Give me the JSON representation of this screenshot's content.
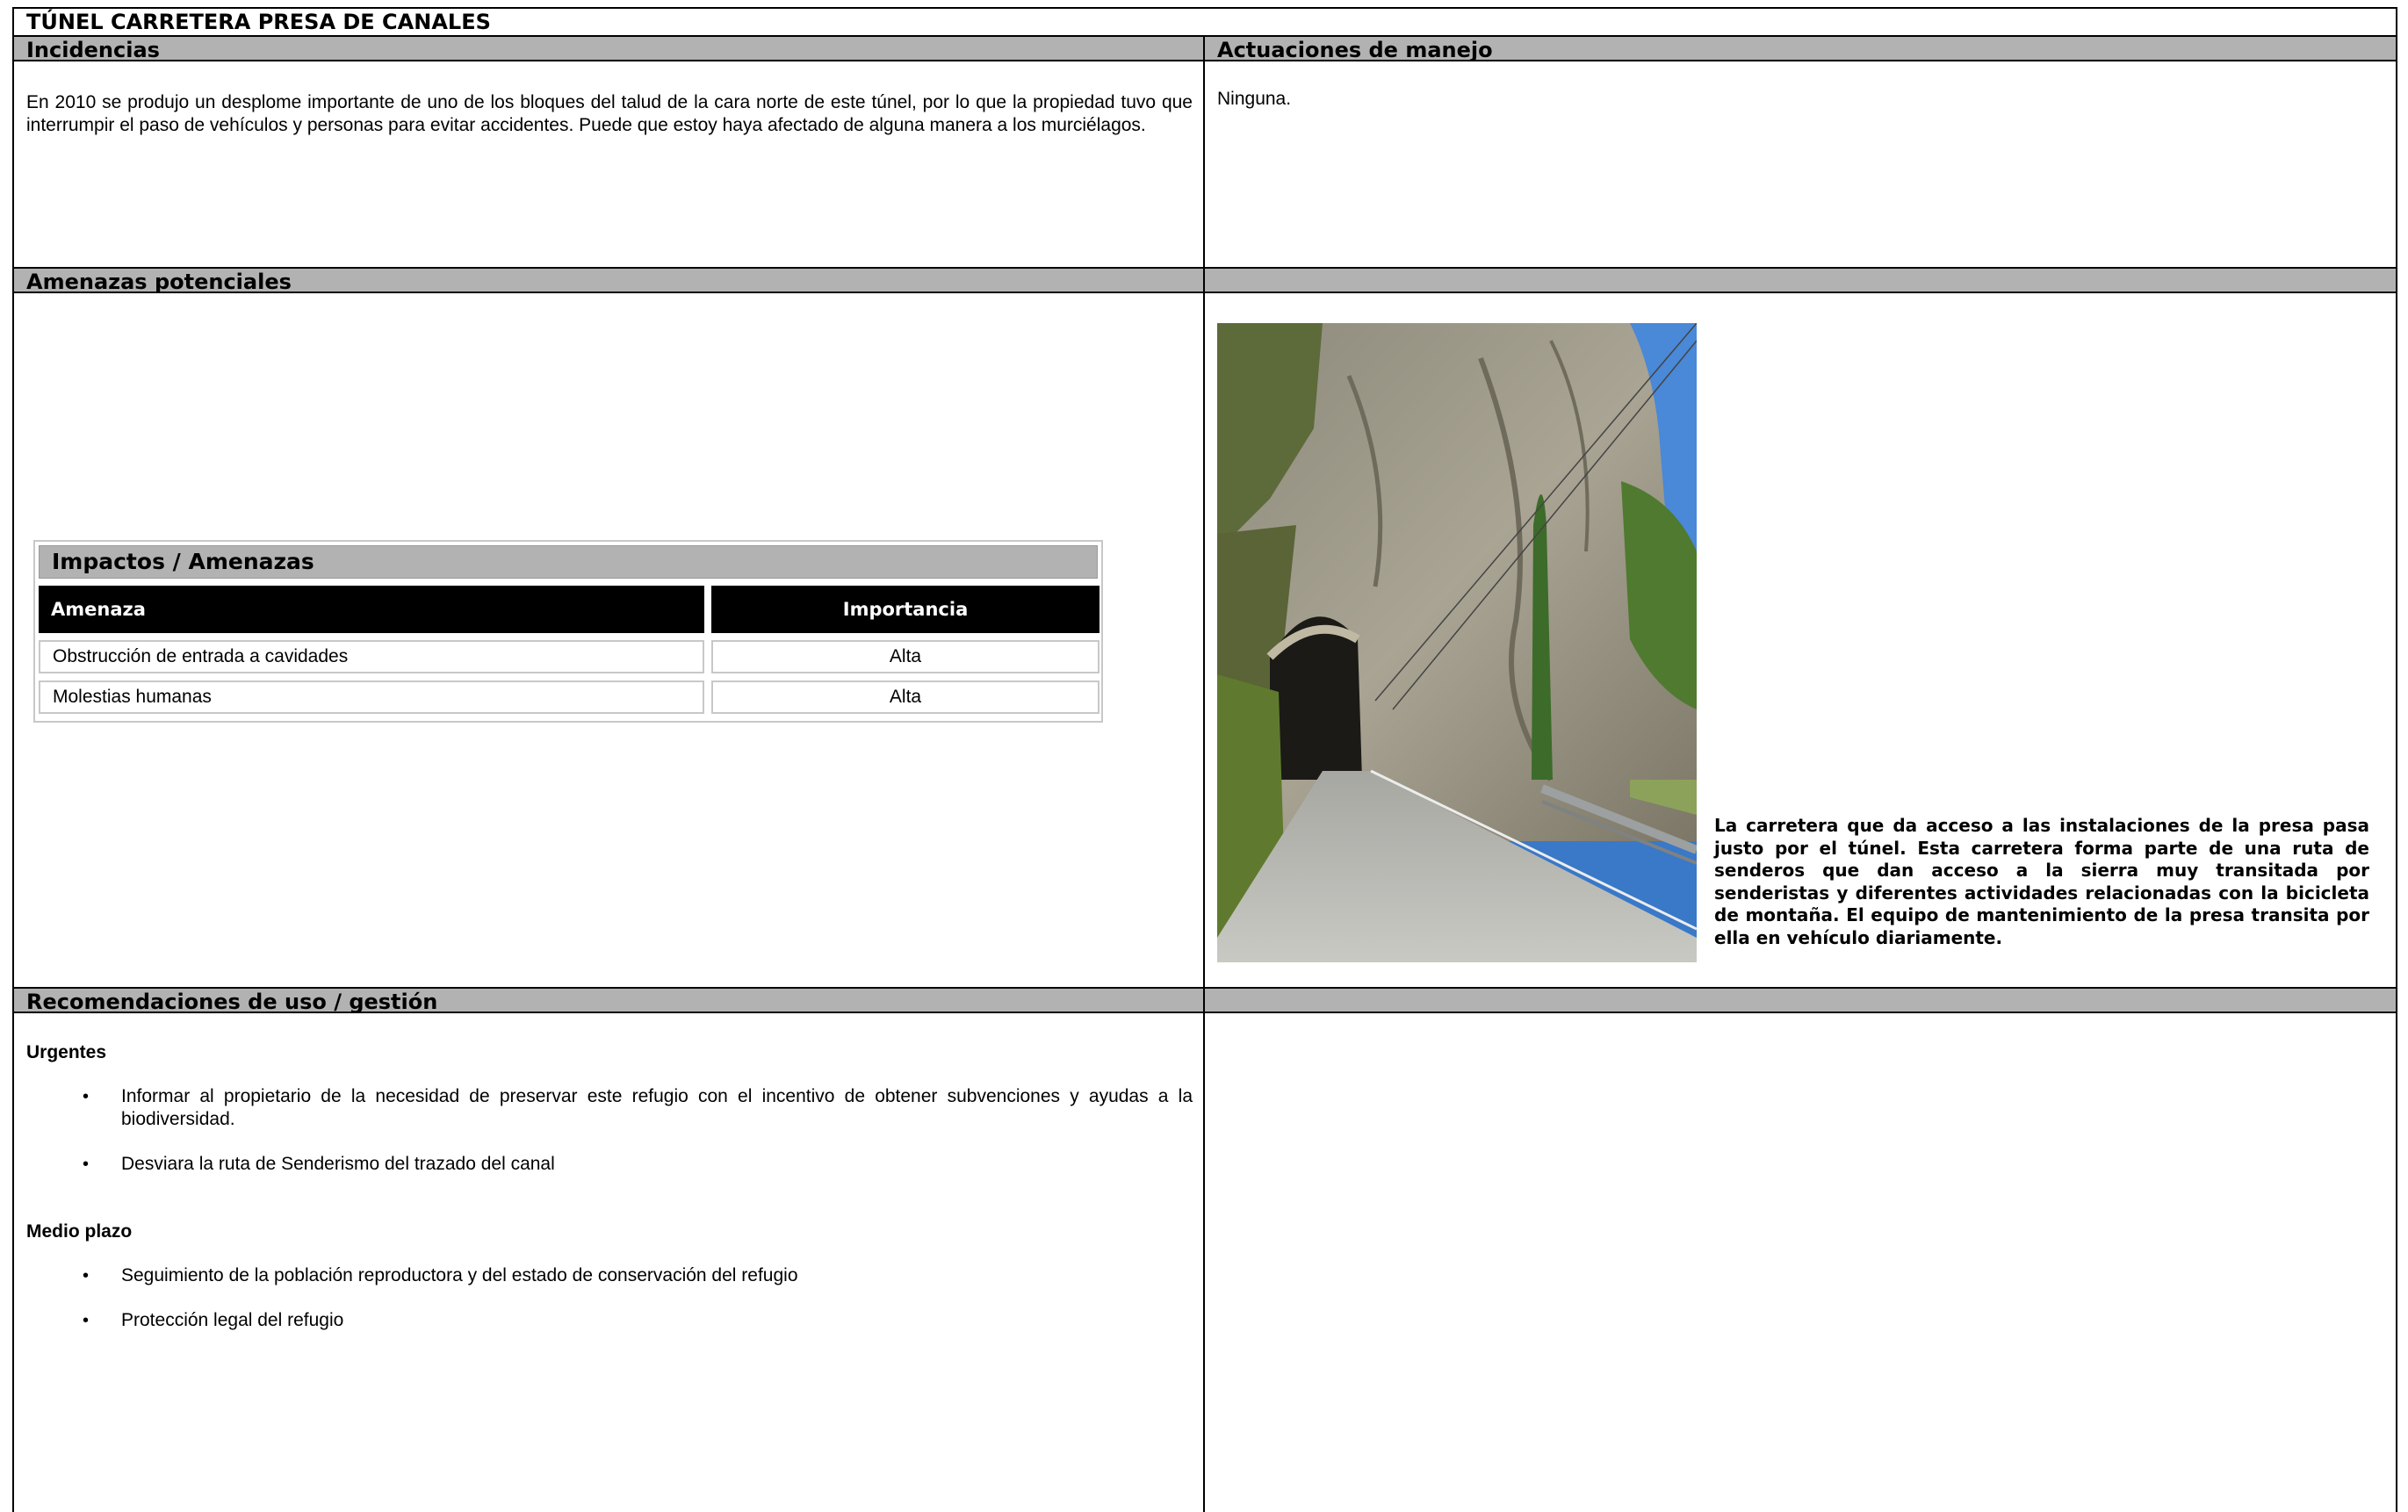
{
  "title": "TÚNEL CARRETERA PRESA DE CANALES",
  "sections": {
    "incidencias": {
      "heading": "Incidencias",
      "text": "En 2010 se produjo un desplome importante de uno de los bloques del talud  de la cara norte de este túnel, por lo que la propiedad tuvo que interrumpir el paso de vehículos y personas para evitar accidentes. Puede que estoy haya afectado de alguna manera a los murciélagos."
    },
    "actuaciones": {
      "heading": "Actuaciones de manejo",
      "text": "Ninguna."
    },
    "amenazas": {
      "heading": "Amenazas potenciales"
    },
    "impactos_table": {
      "title": "Impactos / Amenazas",
      "col_amenaza": "Amenaza",
      "col_importancia": "Importancia",
      "rows": [
        {
          "amenaza": "Obstrucción de entrada a cavidades",
          "importancia": "Alta"
        },
        {
          "amenaza": "Molestias humanas",
          "importancia": "Alta"
        }
      ]
    },
    "photo_caption": "La carretera que da acceso a las instalaciones de la presa pasa justo por el túnel. Esta carretera forma parte de una ruta de senderos que dan acceso a la sierra muy transitada por senderistas y diferentes actividades relacionadas con la bicicleta de montaña. El equipo de mantenimiento de la presa transita por ella en vehículo diariamente.",
    "recomendaciones": {
      "heading": "Recomendaciones de uso / gestión",
      "urgentes_label": "Urgentes",
      "urgentes": [
        "Informar al propietario de la necesidad de preservar este refugio con el incentivo de obtener subvenciones y ayudas a la biodiversidad.",
        "Desviara la ruta de Senderismo del trazado del canal"
      ],
      "medio_label": "Medio plazo",
      "medio": [
        "Seguimiento de la población reproductora y del estado de conservación del refugio",
        "Protección legal del refugio"
      ]
    }
  },
  "colors": {
    "header_bg": "#b2b2b2",
    "table_header_bg": "#000000",
    "border": "#000000"
  }
}
